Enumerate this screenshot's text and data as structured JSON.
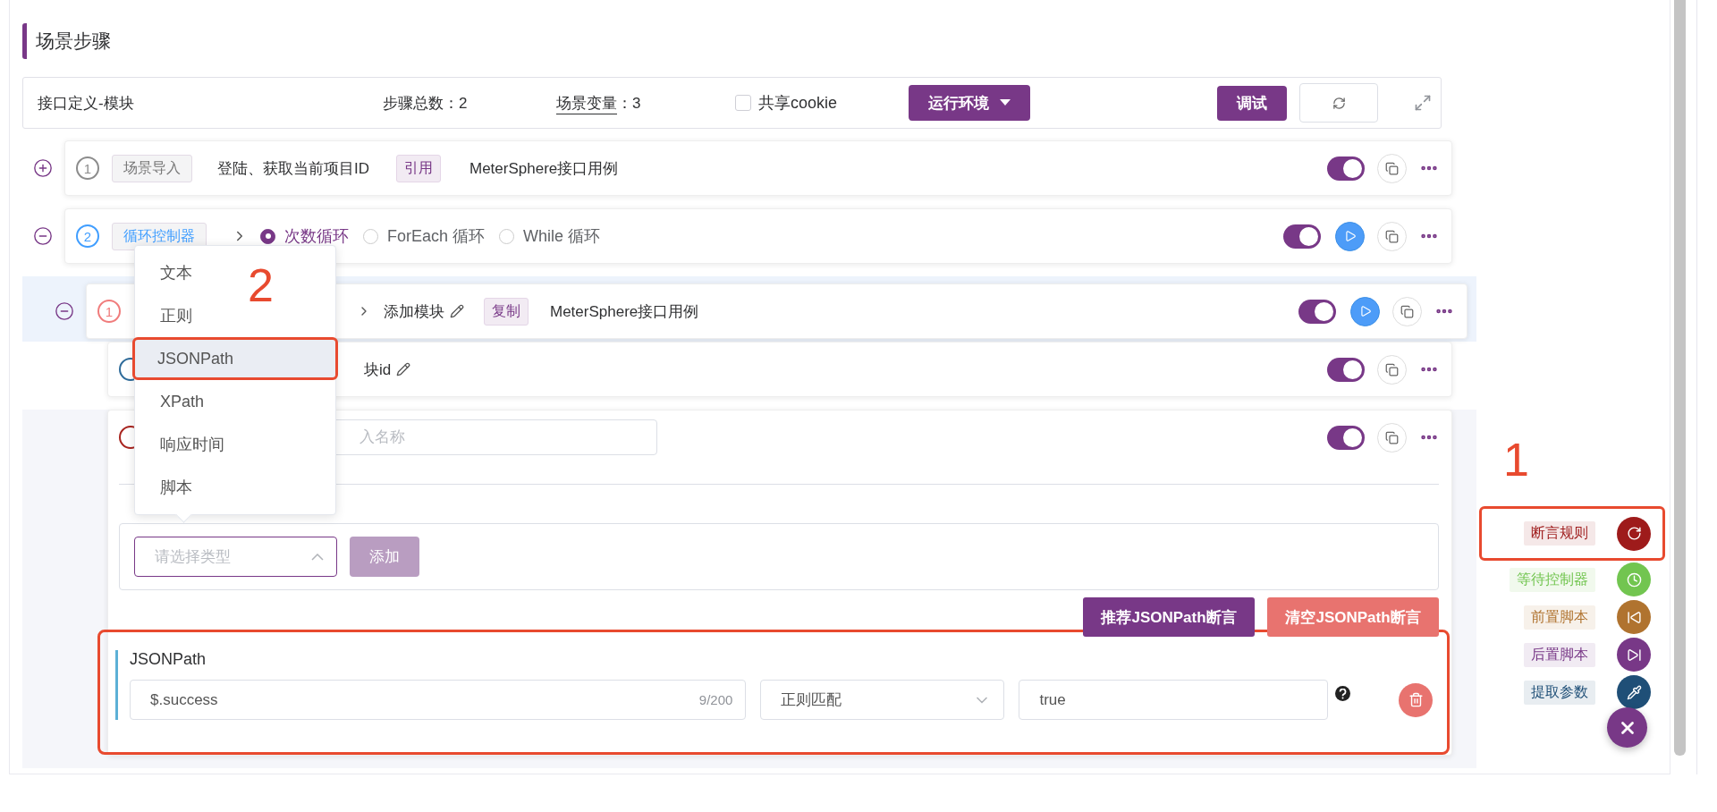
{
  "section_title": "场景步骤",
  "header": {
    "name": "接口定义-模块",
    "step_count_label": "步骤总数：",
    "step_count": "2",
    "variables_label": "场景变量",
    "variables_colon": "：",
    "variables_count": "3",
    "share_cookie": {
      "label": "共享cookie",
      "checked": false
    },
    "env_button": "运行环境",
    "debug_button": "调试"
  },
  "steps": [
    {
      "kind": "scenario",
      "index": "1",
      "color": "#8c8c8c",
      "expanded": false,
      "tag": "场景导入",
      "name": "登陆、获取当前项目ID",
      "badge": "引用",
      "extra": "MeterSphere接口用例",
      "enabled": true,
      "runnable": false
    },
    {
      "kind": "loop",
      "index": "2",
      "color": "#409eff",
      "expanded": true,
      "tag": "循环控制器",
      "loop_types": [
        {
          "label": "次数循环",
          "selected": true
        },
        {
          "label": "ForEach 循环",
          "selected": false
        },
        {
          "label": "While 循环",
          "selected": false
        }
      ],
      "enabled": true,
      "runnable": true,
      "children": [
        {
          "kind": "request",
          "index": "1",
          "color": "#f07c7c",
          "expanded": true,
          "name": "添加模块",
          "badge": "复制",
          "extra": "MeterSphere接口用例",
          "enabled": true,
          "runnable": true,
          "children": [
            {
              "kind": "extract",
              "color": "#2e6b9a",
              "name": "块id",
              "enabled": true,
              "runnable": false
            },
            {
              "kind": "assertion",
              "color": "#a8241f",
              "placeholder": "入名称",
              "enabled": true,
              "runnable": false
            }
          ]
        }
      ]
    }
  ],
  "assertion_panel": {
    "type_select": {
      "placeholder": "请选择类型",
      "expanded": true,
      "options": [
        {
          "label": "文本",
          "selected": false,
          "highlighted": false
        },
        {
          "label": "正则",
          "selected": false,
          "highlighted": false
        },
        {
          "label": "JSONPath",
          "selected": true,
          "highlighted": true
        },
        {
          "label": "XPath",
          "selected": false,
          "highlighted": false
        },
        {
          "label": "响应时间",
          "selected": false,
          "highlighted": false
        },
        {
          "label": "脚本",
          "selected": false,
          "highlighted": false
        }
      ]
    },
    "add_button": {
      "label": "添加",
      "disabled": true
    },
    "actions": [
      {
        "kind": "primary",
        "label": "推荐JSONPath断言"
      },
      {
        "kind": "danger",
        "label": "清空JSONPath断言"
      }
    ],
    "jsonpath": {
      "title": "JSONPath",
      "expression": "$.success",
      "counter": "9/200",
      "condition": "正则匹配",
      "expected": "true",
      "highlighted": true
    }
  },
  "side_menu": {
    "items": [
      {
        "kind": "assert",
        "label": "断言规则",
        "color": "#9e1b1b",
        "highlighted": true
      },
      {
        "kind": "wait",
        "label": "等待控制器",
        "color": "#72c550",
        "highlighted": false
      },
      {
        "kind": "pre",
        "label": "前置脚本",
        "color": "#b0732f",
        "highlighted": false
      },
      {
        "kind": "post",
        "label": "后置脚本",
        "color": "#783887",
        "highlighted": false
      },
      {
        "kind": "extract",
        "label": "提取参数",
        "color": "#1f4f77",
        "highlighted": false
      }
    ]
  },
  "annotations": [
    {
      "label": "2"
    },
    {
      "label": "1"
    }
  ]
}
